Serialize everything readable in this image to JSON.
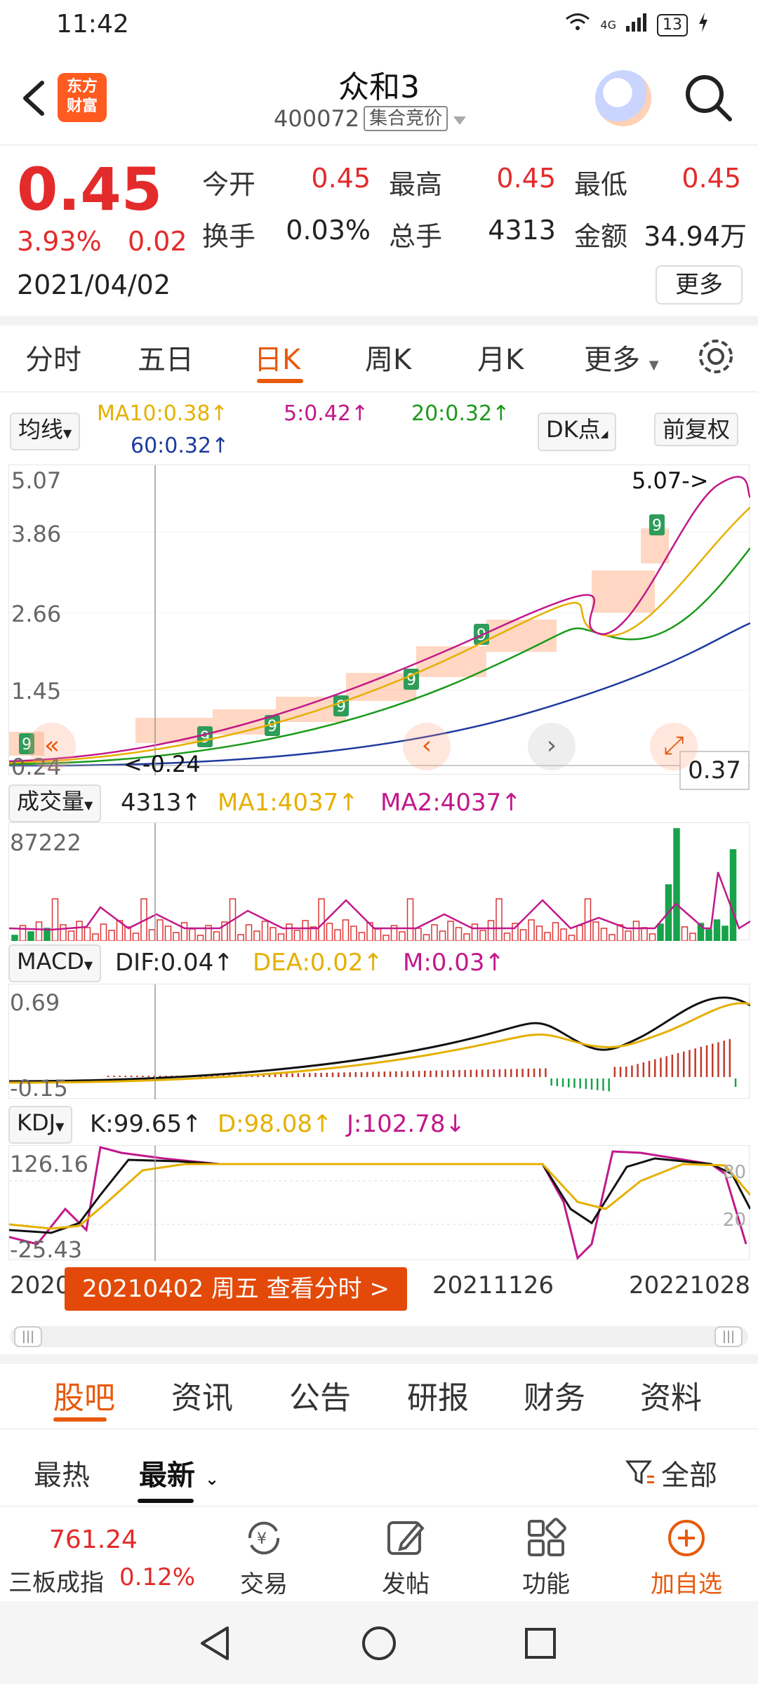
{
  "status_bar": {
    "time": "11:42",
    "network": "4G",
    "battery": "13"
  },
  "header": {
    "logo_text_1": "东方",
    "logo_text_2": "财富",
    "stock_name": "众和3",
    "stock_code": "400072",
    "auction_tag": "集合竞价"
  },
  "quote": {
    "price": "0.45",
    "change_pct": "3.93%",
    "change": "0.02",
    "date": "2021/04/02",
    "open_label": "今开",
    "open": "0.45",
    "high_label": "最高",
    "high": "0.45",
    "low_label": "最低",
    "low": "0.45",
    "turnover_label": "换手",
    "turnover": "0.03%",
    "volume_label": "总手",
    "volume": "4313",
    "amount_label": "金额",
    "amount": "34.94万",
    "more_label": "更多"
  },
  "period_tabs": {
    "intraday": "分时",
    "five_day": "五日",
    "daily": "日K",
    "weekly": "周K",
    "monthly": "月K",
    "more": "更多"
  },
  "indicators": {
    "ma_select": "均线",
    "ma10": "MA10:0.38↑",
    "ma5": "5:0.42↑",
    "ma20": "20:0.32↑",
    "ma60": "60:0.32↑",
    "dk_btn": "DK点",
    "adjust_btn": "前复权"
  },
  "price_axis": {
    "top": "5.07",
    "l2": "3.86",
    "l3": "2.66",
    "l4": "1.45",
    "bottom": "0.24",
    "max_mark": "5.07->",
    "min_mark": "<-0.24",
    "last": "0.37"
  },
  "volume_panel": {
    "select": "成交量",
    "value": "4313↑",
    "ma1": "MA1:4037↑",
    "ma2": "MA2:4037↑",
    "axis_top": "87222"
  },
  "macd_panel": {
    "select": "MACD",
    "dif": "DIF:0.04↑",
    "dea": "DEA:0.02↑",
    "m": "M:0.03↑",
    "axis_top": "0.69",
    "axis_bottom": "-0.15"
  },
  "kdj_panel": {
    "select": "KDJ",
    "k": "K:99.65↑",
    "d": "D:98.08↑",
    "j": "J:102.78↓",
    "axis_top": "126.16",
    "axis_bottom": "-25.43",
    "right_top": "80",
    "right_bottom": "20"
  },
  "date_strip": {
    "left": "2020",
    "tooltip": "20210402 周五 查看分时 >",
    "middle": "20211126",
    "right": "20221028"
  },
  "section_tabs": {
    "guba": "股吧",
    "news": "资讯",
    "notice": "公告",
    "research": "研报",
    "finance": "财务",
    "profile": "资料"
  },
  "sub_tabs": {
    "hot": "最热",
    "new": "最新",
    "filter": "全部"
  },
  "bottom_bar": {
    "index_value": "761.24",
    "index_name": "三板成指",
    "index_pct": "0.12%",
    "trade": "交易",
    "post": "发帖",
    "features": "功能",
    "add_watch": "加自选"
  },
  "colors": {
    "red": "#e32b2b",
    "green": "#16a34a",
    "accent": "#e8590c",
    "ma5": "#c2188b",
    "ma10": "#e5b000",
    "ma20": "#1a9a1a",
    "ma60": "#1d3a9e"
  }
}
